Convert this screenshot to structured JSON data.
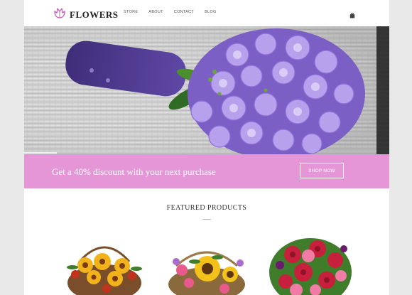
{
  "brand": {
    "name": "FLOWERS",
    "logo_icon": "tulip-icon",
    "accent": "#e496d7"
  },
  "nav": {
    "items": [
      {
        "label": "STORE"
      },
      {
        "label": "ABOUT"
      },
      {
        "label": "CONTACT"
      },
      {
        "label": "BLOG"
      }
    ],
    "cart_icon": "shopping-bag-icon"
  },
  "hero": {
    "image": "purple bouquet photo",
    "slide_indicator": "active"
  },
  "promo": {
    "text": "Get a 40% discount with your next purchase",
    "button_label": "SHOP NOW",
    "background": "#e496d7"
  },
  "featured": {
    "title": "FEATURED PRODUCTS",
    "products": [
      {
        "image": "sunflower-lily-basket"
      },
      {
        "image": "sunflower-mixed-basket"
      },
      {
        "image": "red-pink-rose-bouquet"
      }
    ]
  }
}
